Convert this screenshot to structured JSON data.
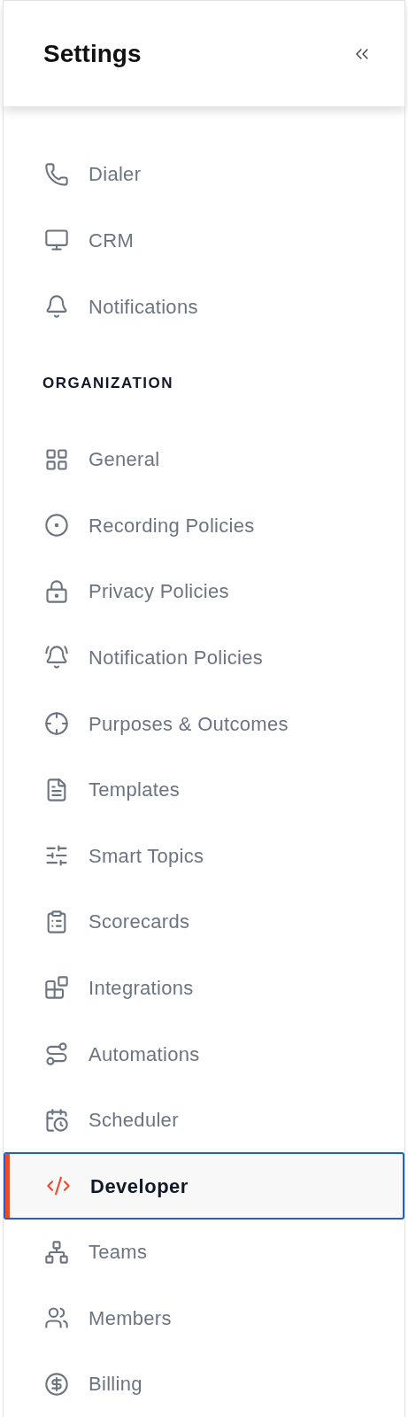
{
  "header": {
    "title": "Settings"
  },
  "sections": [
    {
      "items": [
        {
          "label": "Dialer",
          "selected": false
        },
        {
          "label": "CRM",
          "selected": false
        },
        {
          "label": "Notifications",
          "selected": false
        }
      ]
    },
    {
      "heading": "ORGANIZATION",
      "items": [
        {
          "label": "General",
          "selected": false
        },
        {
          "label": "Recording Policies",
          "selected": false
        },
        {
          "label": "Privacy Policies",
          "selected": false
        },
        {
          "label": "Notification Policies",
          "selected": false
        },
        {
          "label": "Purposes & Outcomes",
          "selected": false
        },
        {
          "label": "Templates",
          "selected": false
        },
        {
          "label": "Smart Topics",
          "selected": false
        },
        {
          "label": "Scorecards",
          "selected": false
        },
        {
          "label": "Integrations",
          "selected": false
        },
        {
          "label": "Automations",
          "selected": false
        },
        {
          "label": "Scheduler",
          "selected": false
        },
        {
          "label": "Developer",
          "selected": true
        },
        {
          "label": "Teams",
          "selected": false
        },
        {
          "label": "Members",
          "selected": false
        },
        {
          "label": "Billing",
          "selected": false
        }
      ]
    }
  ]
}
